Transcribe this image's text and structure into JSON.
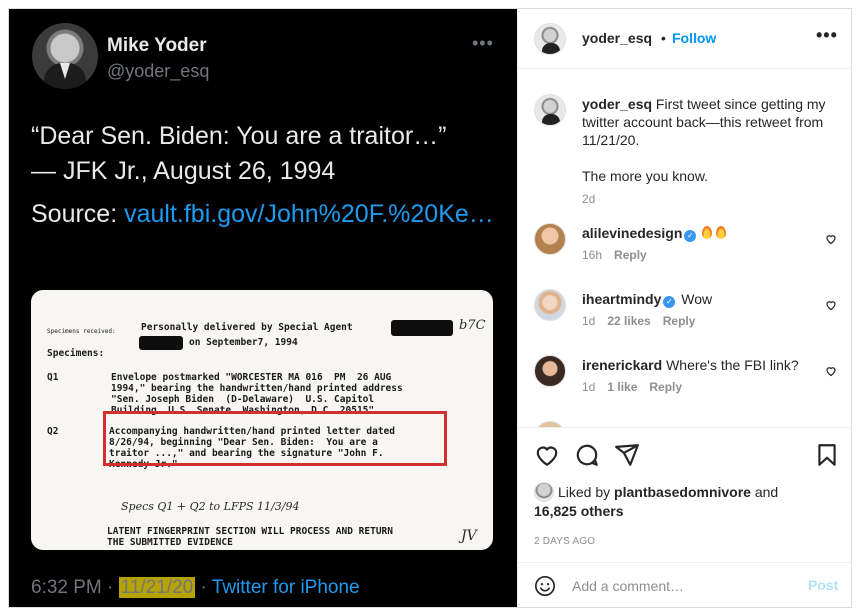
{
  "tweet": {
    "name": "Mike Yoder",
    "handle": "@yoder_esq",
    "more_icon": "more-horizontal-icon",
    "text": "“Dear Sen. Biden: You are a traitor…”\n— JFK Jr., August 26, 1994",
    "source_label": "Source: ",
    "source_link": "vault.fbi.gov/John%20F.%20Ke…",
    "footer_time": "6:32 PM · ",
    "footer_date": "11/21/20",
    "footer_sep": " · ",
    "footer_client": "Twitter for iPhone",
    "highlight_color": "#b7a300",
    "link_color": "#1d9bf0"
  },
  "document": {
    "specimens_received": "Specimens received:",
    "line1": "Personally delivered by Special Agent",
    "line2": "on September7, 1994",
    "specimens": "Specimens:",
    "q1_label": "Q1",
    "q1_text": "Envelope postmarked \"WORCESTER MA 016  PM  26 AUG\n1994,\" bearing the handwritten/hand printed address\n\"Sen. Joseph Biden  (D-Delaware)  U.S. Capitol\nBuilding  U.S. Senate  Washington, D.C. 20515\"",
    "q2_label": "Q2",
    "q2_text": "Accompanying handwritten/hand printed letter dated\n8/26/94, beginning \"Dear Sen. Biden:  You are a\ntraitor ...,\" and bearing the signature \"John F.\nKennedy Jr.\"",
    "margin_note": "b7C",
    "handwritten": "Specs Q1 + Q2 to LFPS  11/3/94",
    "footer": "LATENT FINGERPRINT SECTION WILL PROCESS AND RETURN\nTHE SUBMITTED EVIDENCE",
    "initials": "JV",
    "box_color": "#d0312d"
  },
  "post": {
    "username": "yoder_esq",
    "separator": "•",
    "follow_label": "Follow",
    "more_label": "•••",
    "caption_user": "yoder_esq",
    "caption_text": " First tweet since getting my twitter account back—this retweet from 11/21/20.",
    "caption_text2": "The more you know.",
    "caption_age": "2d",
    "accent": "#0095f6"
  },
  "comments": [
    {
      "user": "alilevinedesign",
      "verified": true,
      "text": "",
      "age": "16h",
      "likes": "",
      "reply": "Reply"
    },
    {
      "user": "iheartmindy",
      "verified": true,
      "text": "Wow",
      "age": "1d",
      "likes": "22 likes",
      "reply": "Reply"
    },
    {
      "user": "irenerickard",
      "verified": false,
      "text": "Where's the FBI link?",
      "age": "1d",
      "likes": "1 like",
      "reply": "Reply"
    }
  ],
  "actions": {
    "like_icon": "heart-icon",
    "comment_icon": "comment-icon",
    "share_icon": "share-icon",
    "save_icon": "bookmark-icon"
  },
  "liked_by": {
    "prefix": "Liked by ",
    "user": "plantbasedomnivore",
    "and": " and",
    "others": "16,825 others"
  },
  "time_ago": "2 DAYS AGO",
  "add_comment": {
    "placeholder": "Add a comment…",
    "post_label": "Post"
  }
}
